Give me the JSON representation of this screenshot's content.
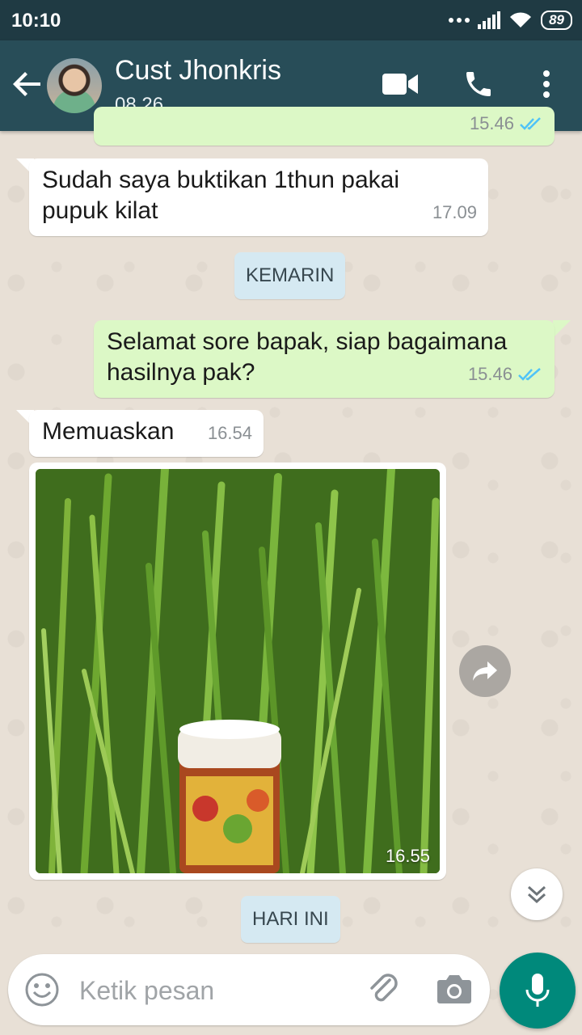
{
  "status_bar": {
    "time": "10:10",
    "battery": "89"
  },
  "header": {
    "contact_name": "Cust Jhonkris",
    "last_seen": "08.26"
  },
  "messages": [
    {
      "type": "outgoing",
      "text": "",
      "time": "15.46",
      "partial": true
    },
    {
      "type": "incoming",
      "text": "Sudah saya buktikan 1thun pakai pupuk kilat",
      "time": "17.09"
    },
    {
      "type": "date",
      "text": "KEMARIN"
    },
    {
      "type": "outgoing",
      "text": "Selamat sore bapak,  siap bagaimana hasilnya pak?",
      "time": "15.46",
      "ticks": "read"
    },
    {
      "type": "incoming",
      "text": "Memuaskan",
      "time": "16.54"
    },
    {
      "type": "incoming-image",
      "caption_time": "16.55"
    },
    {
      "type": "date",
      "text": "HARI INI"
    }
  ],
  "composer": {
    "placeholder": "Ketik pesan"
  },
  "colors": {
    "header": "#284d58",
    "statusbar": "#1f3a43",
    "outgoing_bubble": "#dcf8c6",
    "incoming_bubble": "#ffffff",
    "date_chip": "#d5e9f2",
    "mic_button": "#00897b",
    "read_ticks": "#4fc3f7"
  },
  "icons": [
    "back-arrow-icon",
    "video-call-icon",
    "phone-icon",
    "more-vert-icon",
    "double-check-icon",
    "forward-icon",
    "chevron-double-down-icon",
    "emoji-icon",
    "attach-icon",
    "camera-icon",
    "mic-icon"
  ]
}
